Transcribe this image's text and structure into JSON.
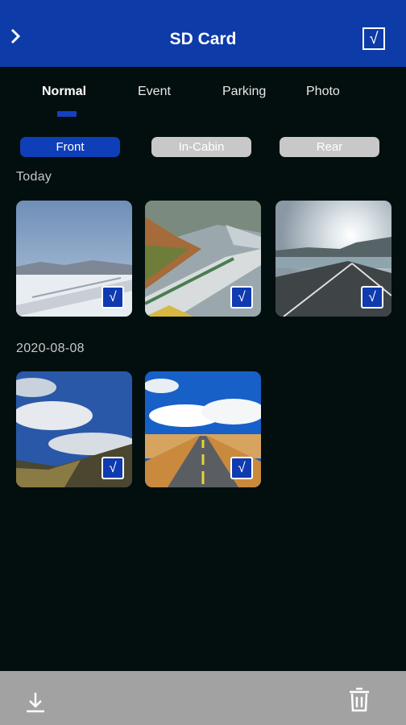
{
  "header": {
    "title": "SD Card",
    "back_icon": "chevron-right-icon",
    "select_all_icon": "checkbox-checked-icon",
    "select_all_glyph": "√",
    "background_color": "#0d3ba8"
  },
  "tabs": [
    {
      "label": "Normal",
      "active": true
    },
    {
      "label": "Event",
      "active": false
    },
    {
      "label": "Parking",
      "active": false
    },
    {
      "label": "Photo",
      "active": false
    }
  ],
  "cameras": [
    {
      "label": "Front",
      "active": true
    },
    {
      "label": "In-Cabin",
      "active": false
    },
    {
      "label": "Rear",
      "active": false
    }
  ],
  "groups": [
    {
      "title": "Today",
      "items": [
        {
          "scene": "snowy-mountain-road",
          "selected": true,
          "check": "√"
        },
        {
          "scene": "mountain-highway",
          "selected": true,
          "check": "√"
        },
        {
          "scene": "coastal-road-sunlight",
          "selected": true,
          "check": "√"
        }
      ]
    },
    {
      "title": "2020-08-08",
      "items": [
        {
          "scene": "clouds-mountain-landscape",
          "selected": true,
          "check": "√"
        },
        {
          "scene": "straight-desert-road",
          "selected": true,
          "check": "√"
        }
      ]
    }
  ],
  "footer": {
    "download_icon": "download-icon",
    "delete_icon": "trash-icon"
  },
  "colors": {
    "accent": "#0e3fb8",
    "background": "#030f0f",
    "bottom_bar": "#a2a2a2",
    "inactive_button": "#c8c8c8"
  }
}
